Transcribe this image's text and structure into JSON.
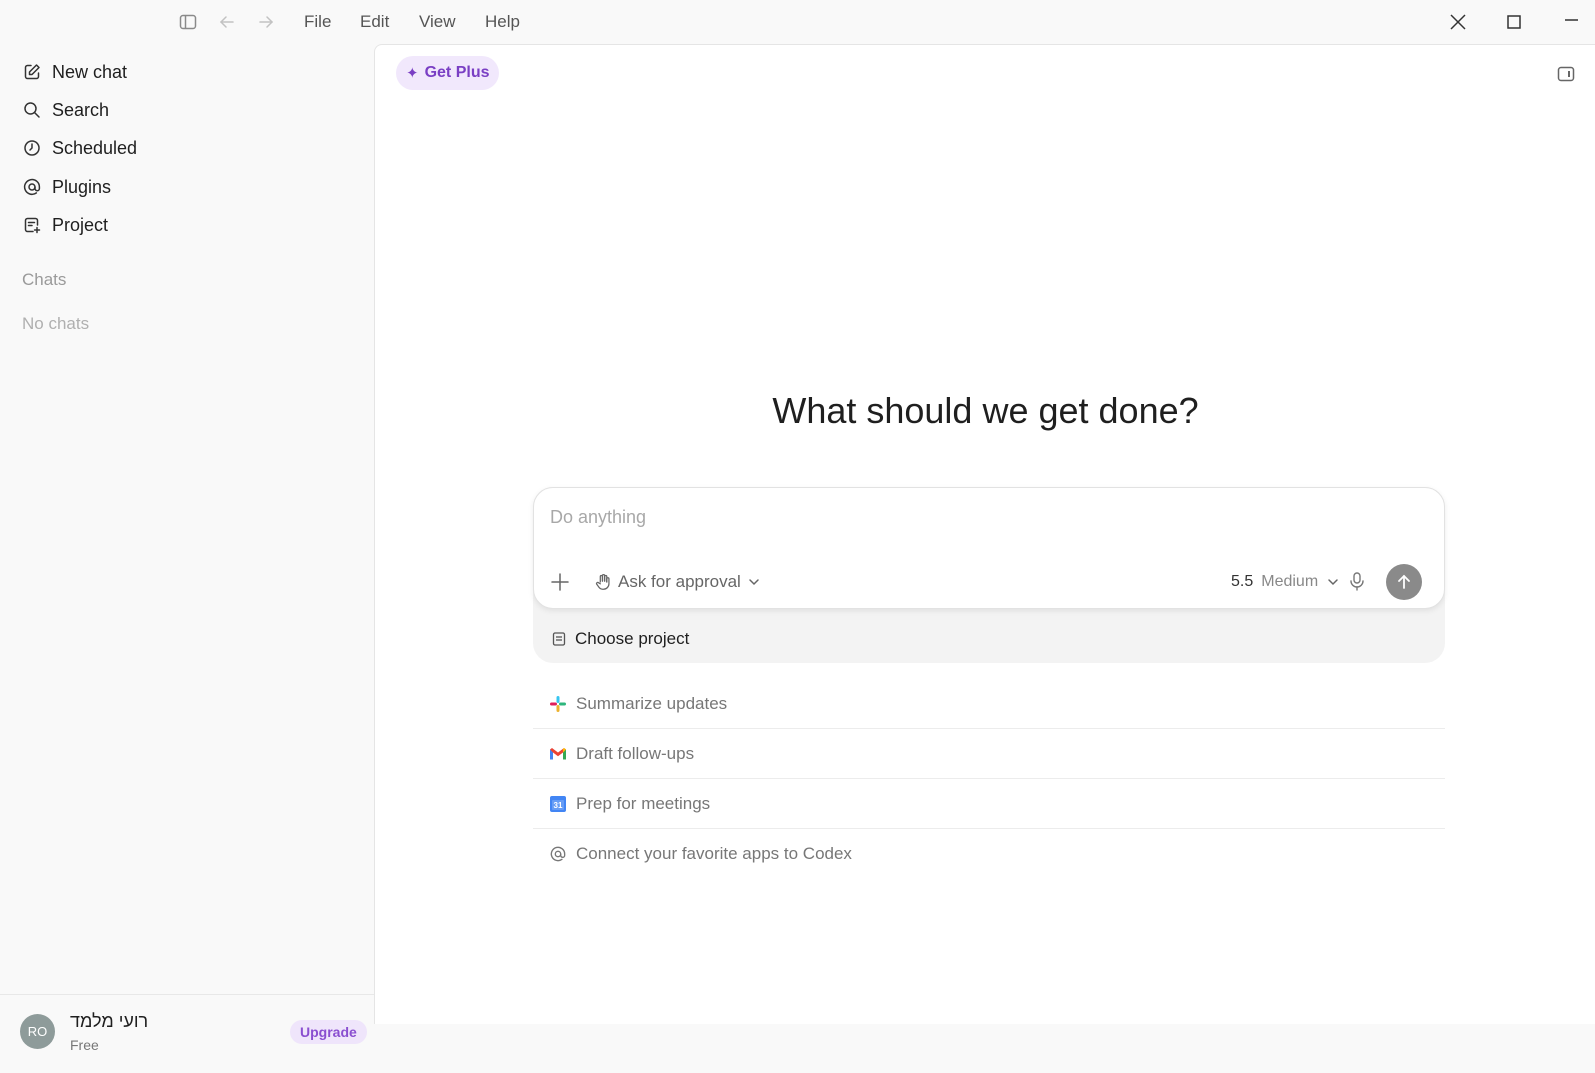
{
  "menu": {
    "file": "File",
    "edit": "Edit",
    "view": "View",
    "help": "Help"
  },
  "sidebar": {
    "items": [
      {
        "label": "New chat"
      },
      {
        "label": "Search"
      },
      {
        "label": "Scheduled"
      },
      {
        "label": "Plugins"
      },
      {
        "label": "Project"
      }
    ],
    "chats_label": "Chats",
    "empty_label": "No chats"
  },
  "user": {
    "initials": "RO",
    "name": "רועי מלמד",
    "plan": "Free",
    "upgrade_label": "Upgrade"
  },
  "main": {
    "get_plus_label": "Get Plus",
    "heading": "What should we get done?",
    "composer": {
      "placeholder": "Do anything",
      "approval_label": "Ask for approval",
      "model_version": "5.5",
      "model_effort": "Medium"
    },
    "choose_project_label": "Choose project",
    "suggestions": [
      {
        "label": "Summarize updates",
        "icon": "slack-icon"
      },
      {
        "label": "Draft follow-ups",
        "icon": "gmail-icon"
      },
      {
        "label": "Prep for meetings",
        "icon": "calendar-icon"
      },
      {
        "label": "Connect your favorite apps to Codex",
        "icon": "at-sign-icon"
      }
    ]
  },
  "colors": {
    "accent": "#7a3fc4",
    "accent_bg": "#f1e8fc",
    "send_button": "#8a8a8a"
  }
}
